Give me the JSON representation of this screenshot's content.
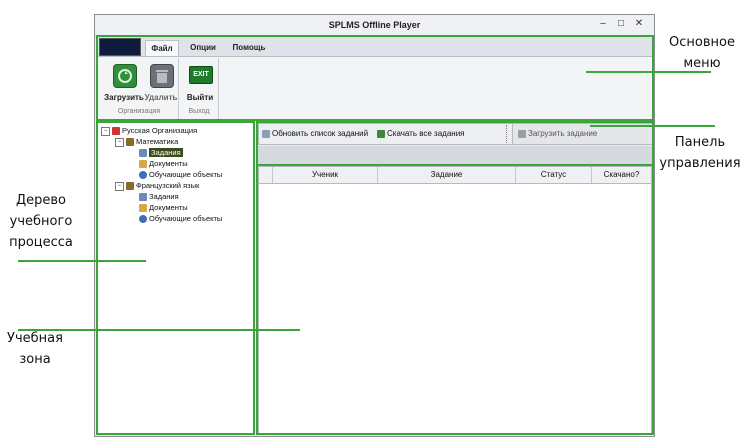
{
  "window": {
    "title": "SPLMS Offline Player",
    "controls": [
      "minimize-icon",
      "maximize-icon",
      "close-icon"
    ]
  },
  "ribbon": {
    "tabs": [
      "Файл",
      "Опции",
      "Помощь"
    ],
    "active_tab": "Файл",
    "groups": [
      {
        "label": "Организация",
        "buttons": [
          {
            "label": "Загрузить",
            "icon": "download-icon"
          },
          {
            "label": "Удалить",
            "icon": "delete-icon"
          }
        ]
      },
      {
        "label": "Выход",
        "buttons": [
          {
            "label": "Выйти",
            "icon": "exit-icon",
            "icon_text": "EXIT"
          }
        ]
      }
    ]
  },
  "tree": {
    "root": "Русская Организация",
    "courses": [
      {
        "name": "Математика",
        "children": [
          "Задания",
          "Документы",
          "Обучающие объекты"
        ]
      },
      {
        "name": "Французский язык",
        "children": [
          "Задания",
          "Документы",
          "Обучающие объекты"
        ]
      }
    ],
    "selected": "Задания"
  },
  "toolbar": {
    "refresh_label": "Обновить список заданий",
    "download_all_label": "Скачать все задания",
    "upload_label": "Загрузить задание"
  },
  "grid": {
    "columns": [
      "",
      "Ученик",
      "Задание",
      "Статус",
      "Скачано?"
    ]
  },
  "annotations": {
    "main_menu": "Основное\nменю",
    "control_panel": "Панель\nуправления",
    "tree": "Дерево\nучебного\nпроцесса",
    "learning_zone": "Учебная\nзона"
  },
  "colors": {
    "annotation": "#3aa63a",
    "app_button": "#0f1b3a"
  }
}
